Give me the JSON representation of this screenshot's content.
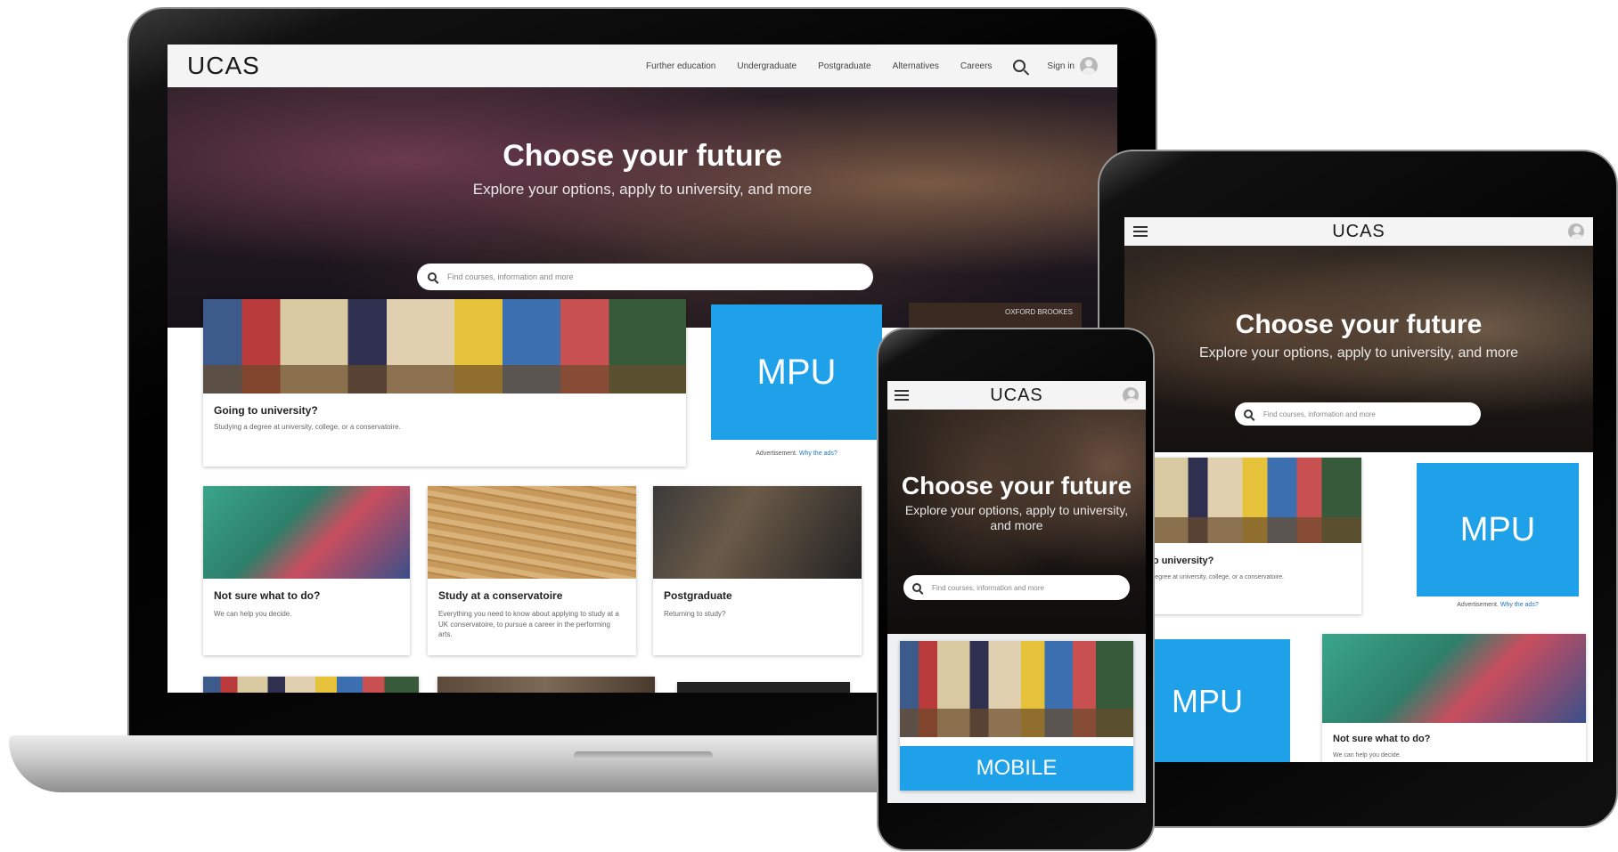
{
  "brand": {
    "logo": "UCAS",
    "accent": "#1ea1e8"
  },
  "desktop": {
    "nav": [
      "Further education",
      "Undergraduate",
      "Postgraduate",
      "Alternatives",
      "Careers"
    ],
    "signin": "Sign in",
    "hero_title": "Choose your future",
    "hero_sub": "Explore your options, apply to university, and more",
    "search_placeholder": "Find courses, information and more",
    "featured": {
      "title": "Going to university?",
      "text": "Studying a degree at university, college, or a conservatoire."
    },
    "mpu": "MPU",
    "ad_note": "Advertisement.",
    "ad_link": "Why the ads?",
    "partner_logo": "OXFORD BROOKES",
    "cards": [
      {
        "title": "Not sure what to do?",
        "text": "We can help you decide."
      },
      {
        "title": "Study at a conservatoire",
        "text": "Everything you need to know about applying to study at a UK conservatoire, to pursue a career in the performing arts."
      },
      {
        "title": "Postgraduate",
        "text": "Returning to study?"
      }
    ]
  },
  "tablet": {
    "hero_title": "Choose your future",
    "hero_sub": "Explore your options, apply to university, and more",
    "search_placeholder": "Find courses, information and more",
    "featured": {
      "title": "oing to university?",
      "text": "udying a degree at university, college, or a conservatoire."
    },
    "mpu": "MPU",
    "mpu2": "MPU",
    "ad_note": "Advertisement.",
    "ad_link": "Why the ads?",
    "card": {
      "title": "Not sure what to do?",
      "text": "We can help you decide."
    }
  },
  "phone": {
    "hero_title": "Choose your future",
    "hero_sub": "Explore your options, apply to university, and more",
    "search_placeholder": "Find courses, information and more",
    "mobile_banner": "MOBILE"
  }
}
